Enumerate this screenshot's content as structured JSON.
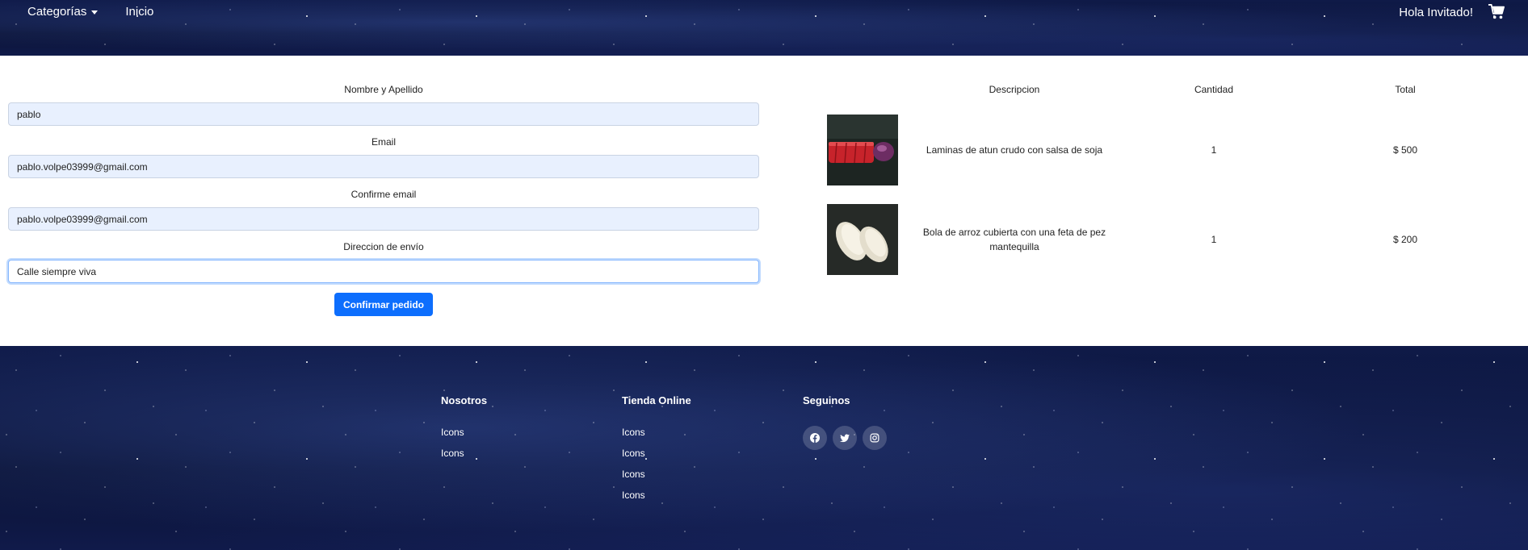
{
  "navbar": {
    "categories_label": "Categorías",
    "home_label": "Inicio",
    "greeting": "Hola Invitado!"
  },
  "form": {
    "name_label": "Nombre y Apellido",
    "name_value": "pablo",
    "email_label": "Email",
    "email_value": "pablo.volpe03999@gmail.com",
    "confirm_email_label": "Confirme email",
    "confirm_email_value": "pablo.volpe03999@gmail.com",
    "address_label": "Direccion de envío",
    "address_value": "Calle siempre viva",
    "submit_label": "Confirmar pedido"
  },
  "cart": {
    "headers": {
      "description": "Descripcion",
      "quantity": "Cantidad",
      "total": "Total"
    },
    "items": [
      {
        "description": "Laminas de atun crudo con salsa de soja",
        "quantity": "1",
        "total": "$ 500"
      },
      {
        "description": "Bola de arroz cubierta con una feta de pez mantequilla",
        "quantity": "1",
        "total": "$ 200"
      }
    ]
  },
  "footer": {
    "col1": {
      "title": "Nosotros",
      "links": [
        "Icons",
        "Icons"
      ]
    },
    "col2": {
      "title": "Tienda Online",
      "links": [
        "Icons",
        "Icons",
        "Icons",
        "Icons"
      ]
    },
    "col3": {
      "title": "Seguinos",
      "socials": [
        "facebook-icon",
        "twitter-icon",
        "instagram-icon"
      ]
    }
  },
  "colors": {
    "primary": "#0d6efd",
    "input_bg": "#e8f0fe",
    "navbar_bg": "#0d1640"
  }
}
